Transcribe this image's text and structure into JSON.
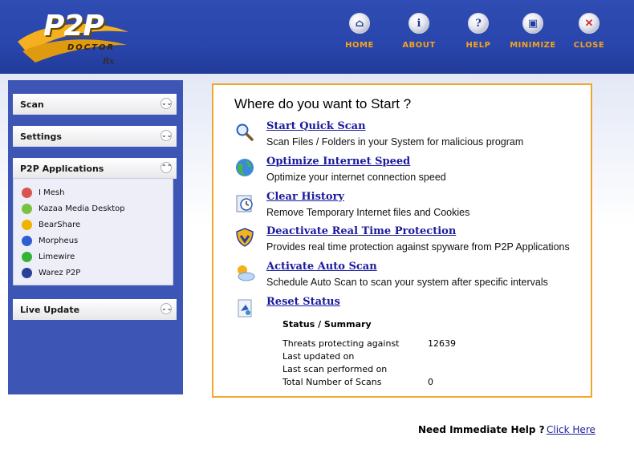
{
  "header": {
    "logo_text": "P2P",
    "logo_sub": "DOCTOR",
    "logo_rx": "Rx",
    "nav": [
      {
        "label": "HOME",
        "icon": "home-icon",
        "glyph": "⌂"
      },
      {
        "label": "ABOUT",
        "icon": "info-icon",
        "glyph": "i"
      },
      {
        "label": "HELP",
        "icon": "help-icon",
        "glyph": "?"
      },
      {
        "label": "MINIMIZE",
        "icon": "minimize-icon",
        "glyph": "▣"
      },
      {
        "label": "CLOSE",
        "icon": "close-icon",
        "glyph": "✕"
      }
    ]
  },
  "sidebar": {
    "sections": [
      {
        "label": "Scan",
        "state": "collapsed"
      },
      {
        "label": "Settings",
        "state": "collapsed"
      },
      {
        "label": "P2P Applications",
        "state": "expanded"
      },
      {
        "label": "Live Update",
        "state": "collapsed"
      }
    ],
    "p2p_apps": [
      {
        "label": "I Mesh",
        "color": "#d9534f"
      },
      {
        "label": "Kazaa Media Desktop",
        "color": "#7ac142"
      },
      {
        "label": "BearShare",
        "color": "#f0b400"
      },
      {
        "label": "Morpheus",
        "color": "#2d5fd0"
      },
      {
        "label": "Limewire",
        "color": "#35b335"
      },
      {
        "label": "Warez P2P",
        "color": "#2a3f9a"
      }
    ]
  },
  "panel": {
    "title": "Where do you want to Start ?",
    "actions": [
      {
        "label": "Start Quick Scan",
        "desc": "Scan Files / Folders in your System for malicious program",
        "icon": "magnifier-icon"
      },
      {
        "label": "Optimize Internet Speed",
        "desc": "Optimize your internet connection speed",
        "icon": "globe-icon"
      },
      {
        "label": "Clear History",
        "desc": "Remove Temporary Internet files and Cookies",
        "icon": "history-clock-icon"
      },
      {
        "label": "Deactivate Real Time Protection",
        "desc": "Provides real time protection against spyware from P2P Applications",
        "icon": "shield-icon"
      },
      {
        "label": "Activate Auto Scan",
        "desc": "Schedule Auto Scan to scan your system after specific intervals",
        "icon": "auto-scan-icon"
      },
      {
        "label": "Reset Status",
        "desc": "",
        "icon": "reset-icon"
      }
    ],
    "status": {
      "heading": "Status / Summary",
      "rows": [
        {
          "key": "Threats protecting against",
          "value": "12639"
        },
        {
          "key": "Last updated on",
          "value": ""
        },
        {
          "key": "Last scan performed on",
          "value": ""
        },
        {
          "key": "Total Number of Scans",
          "value": "0"
        }
      ]
    }
  },
  "footer": {
    "question": "Need Immediate Help ?",
    "link": "Click Here"
  },
  "colors": {
    "header_blue": "#2946ad",
    "nav_label": "#f4a21a",
    "panel_border": "#f0a82c",
    "link": "#1b1b9e",
    "sidebar_blue": "#3d56b6"
  }
}
